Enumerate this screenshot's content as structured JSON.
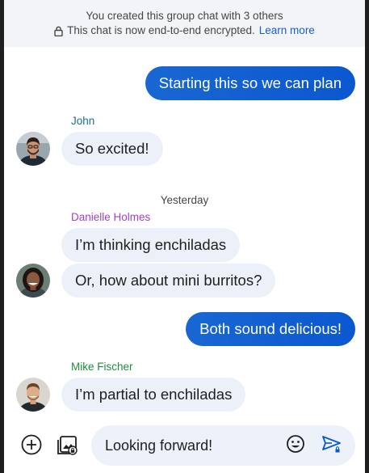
{
  "banner": {
    "line1": "You created this group chat with 3 others",
    "line2": "This chat is now end-to-end encrypted.",
    "link": "Learn more"
  },
  "messages": {
    "m1": "Starting this so we can plan",
    "john_name": "John",
    "m2": "So excited!",
    "day_divider": "Yesterday",
    "danielle_name": "Danielle Holmes",
    "m3": "I’m thinking enchiladas",
    "m4": "Or, how about mini burritos?",
    "m5": "Both sound delicious!",
    "mike_name": "Mike Fischer",
    "m6": "I’m partial to enchiladas"
  },
  "composer": {
    "value": "Looking forward!"
  },
  "colors": {
    "john": "#1f6e8c",
    "danielle": "#a142c4",
    "mike": "#1e8e3e",
    "outgoing": "#0b57d0"
  }
}
